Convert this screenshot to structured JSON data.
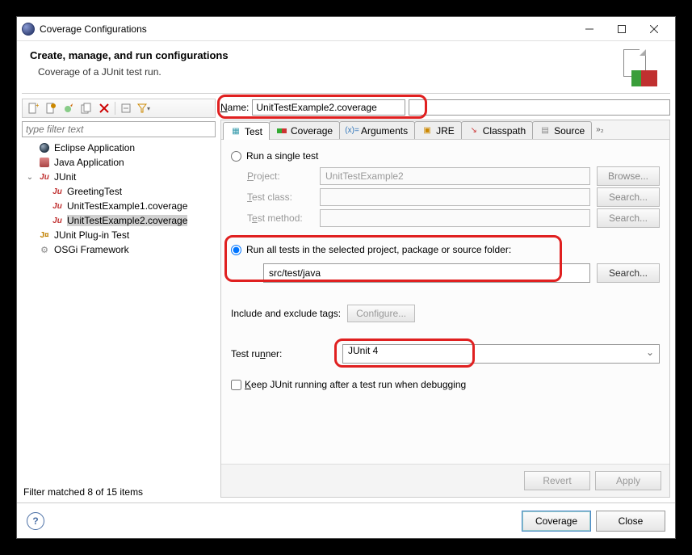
{
  "window": {
    "title": "Coverage Configurations"
  },
  "header": {
    "title": "Create, manage, and run configurations",
    "subtitle": "Coverage of a JUnit test run."
  },
  "left": {
    "filter_placeholder": "type filter text",
    "items": [
      {
        "label": "Eclipse Application",
        "icon": "eclipse",
        "level": 0
      },
      {
        "label": "Java Application",
        "icon": "java",
        "level": 0
      },
      {
        "label": "JUnit",
        "icon": "junit",
        "level": 0,
        "expandable": true,
        "expanded": true
      },
      {
        "label": "GreetingTest",
        "icon": "junit",
        "level": 1
      },
      {
        "label": "UnitTestExample1.coverage",
        "icon": "junit",
        "level": 1
      },
      {
        "label": "UnitTestExample2.coverage",
        "icon": "junit",
        "level": 1,
        "selected": true
      },
      {
        "label": "JUnit Plug-in Test",
        "icon": "junit-plugin",
        "level": 0
      },
      {
        "label": "OSGi Framework",
        "icon": "osgi",
        "level": 0
      }
    ],
    "status": "Filter matched 8 of 15 items"
  },
  "name": {
    "label": "Name:",
    "value": "UnitTestExample2.coverage"
  },
  "tabs": [
    {
      "label": "Test",
      "icon": "test",
      "active": true
    },
    {
      "label": "Coverage",
      "icon": "coverage"
    },
    {
      "label": "Arguments",
      "icon": "args"
    },
    {
      "label": "JRE",
      "icon": "jre"
    },
    {
      "label": "Classpath",
      "icon": "classpath"
    },
    {
      "label": "Source",
      "icon": "source"
    }
  ],
  "tabs_more": "»₂",
  "form": {
    "single_test_label": "Run a single test",
    "project_label": "Project:",
    "project_value": "UnitTestExample2",
    "browse": "Browse...",
    "test_class_label": "Test class:",
    "test_method_label": "Test method:",
    "search": "Search...",
    "run_all_label": "Run all tests in the selected project, package or source folder:",
    "run_all_path": "src/test/java",
    "tags_label": "Include and exclude tags:",
    "configure": "Configure...",
    "runner_label": "Test runner:",
    "runner_value": "JUnit 4",
    "keep_label": "Keep JUnit running after a test run when debugging"
  },
  "buttons": {
    "revert": "Revert",
    "apply": "Apply"
  },
  "footer": {
    "coverage": "Coverage",
    "close": "Close"
  }
}
